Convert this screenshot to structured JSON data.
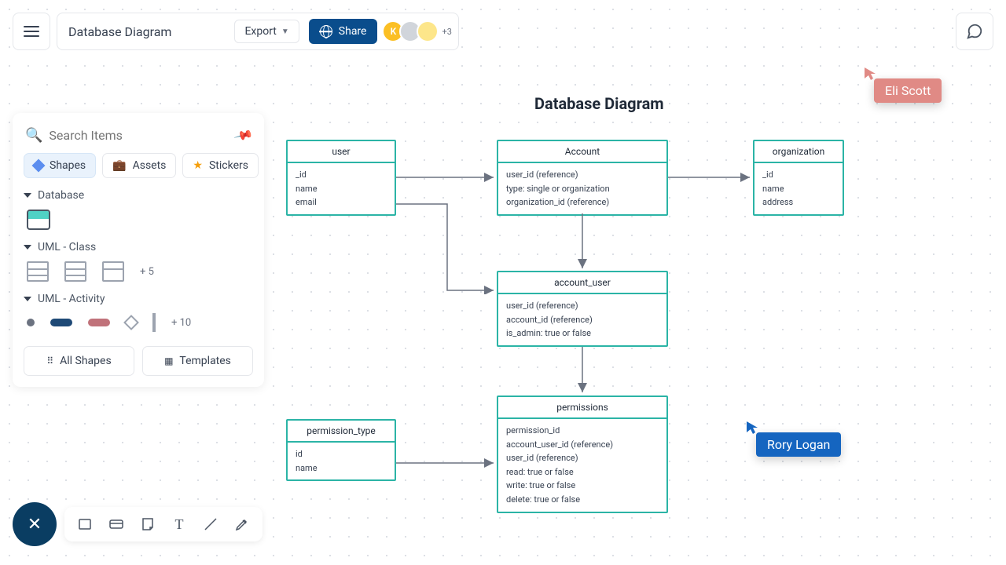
{
  "header": {
    "doc_title": "Database Diagram",
    "export_label": "Export",
    "share_label": "Share",
    "avatar_letter": "K",
    "avatar_more": "+3"
  },
  "search": {
    "placeholder": "Search Items"
  },
  "tabs": {
    "shapes": "Shapes",
    "assets": "Assets",
    "stickers": "Stickers"
  },
  "sections": {
    "database": "Database",
    "uml_class": "UML - Class",
    "uml_class_more": "+ 5",
    "uml_activity": "UML - Activity",
    "uml_activity_more": "+ 10"
  },
  "buttons": {
    "all_shapes": "All Shapes",
    "templates": "Templates"
  },
  "canvas": {
    "title": "Database Diagram"
  },
  "entities": {
    "user": {
      "name": "user",
      "fields": [
        "_id",
        "name",
        "email"
      ]
    },
    "account": {
      "name": "Account",
      "fields": [
        "user_id (reference)",
        "type: single or organization",
        "organization_id (reference)"
      ]
    },
    "organization": {
      "name": "organization",
      "fields": [
        "_id",
        "name",
        "address"
      ]
    },
    "account_user": {
      "name": "account_user",
      "fields": [
        "user_id (reference)",
        "account_id (reference)",
        "is_admin: true or false"
      ]
    },
    "permission_type": {
      "name": "permission_type",
      "fields": [
        "id",
        "name"
      ]
    },
    "permissions": {
      "name": "permissions",
      "fields": [
        "permission_id",
        "account_user_id (reference)",
        "user_id (reference)",
        "read: true or false",
        "write: true or false",
        "delete: true or false"
      ]
    }
  },
  "cursors": {
    "eli": "Eli Scott",
    "rory": "Rory Logan"
  }
}
